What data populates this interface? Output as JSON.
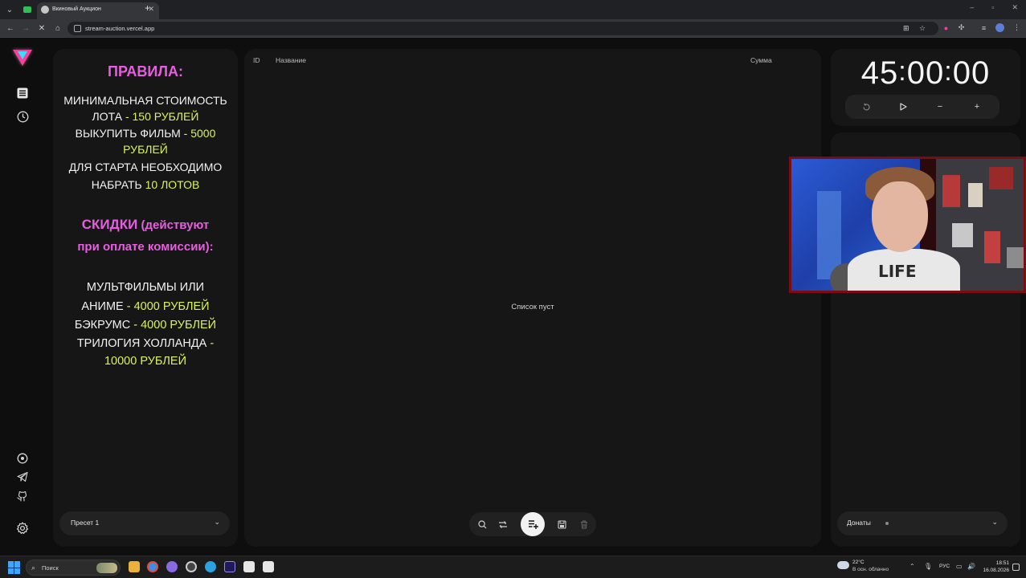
{
  "browser": {
    "tab_title": "Вкиновый Аукцион",
    "url": "stream-auction.vercel.app"
  },
  "rules": {
    "heading": "ПРАВИЛА:",
    "line1": "МИНИМАЛЬНАЯ СТОИМОСТЬ",
    "line2a": "ЛОТА",
    "line2b": " - 150 РУБЛЕЙ",
    "line3a": "ВЫКУПИТЬ ФИЛЬМ",
    "line3b": " - 5000",
    "line4": "РУБЛЕЙ",
    "line5": "ДЛЯ СТАРТА НЕОБХОДИМО",
    "line6a": "НАБРАТЬ ",
    "line6b": "10 ЛОТОВ",
    "discounts_a": "СКИДКИ",
    "discounts_b": " (действуют",
    "discounts_c": "при оплате комиссии):",
    "d1": "МУЛЬТФИЛЬМЫ ИЛИ",
    "d2a": "АНИМЕ",
    "d2b": " - 4000 РУБЛЕЙ",
    "d3a": "БЭКРУМС",
    "d3b": " - 4000 РУБЛЕЙ",
    "d4a": "ТРИЛОГИЯ ХОЛЛАНДА",
    "d4b": " -",
    "d5": "10000 РУБЛЕЙ"
  },
  "preset": {
    "selected": "Пресет 1"
  },
  "lots_table": {
    "columns": {
      "id": "ID",
      "name": "Название",
      "sum": "Сумма"
    },
    "empty_message": "Список пуст"
  },
  "timer": {
    "hours": "45",
    "minutes": "00",
    "seconds": "00"
  },
  "donates": {
    "label": "Донаты"
  },
  "taskbar": {
    "search_label": "Поиск",
    "weather_temp": "22°C",
    "weather_desc": "В осн. облачно",
    "language": "РУС",
    "time": "18:51",
    "date": "16.08.2026"
  },
  "webcam_print": "LIFE"
}
